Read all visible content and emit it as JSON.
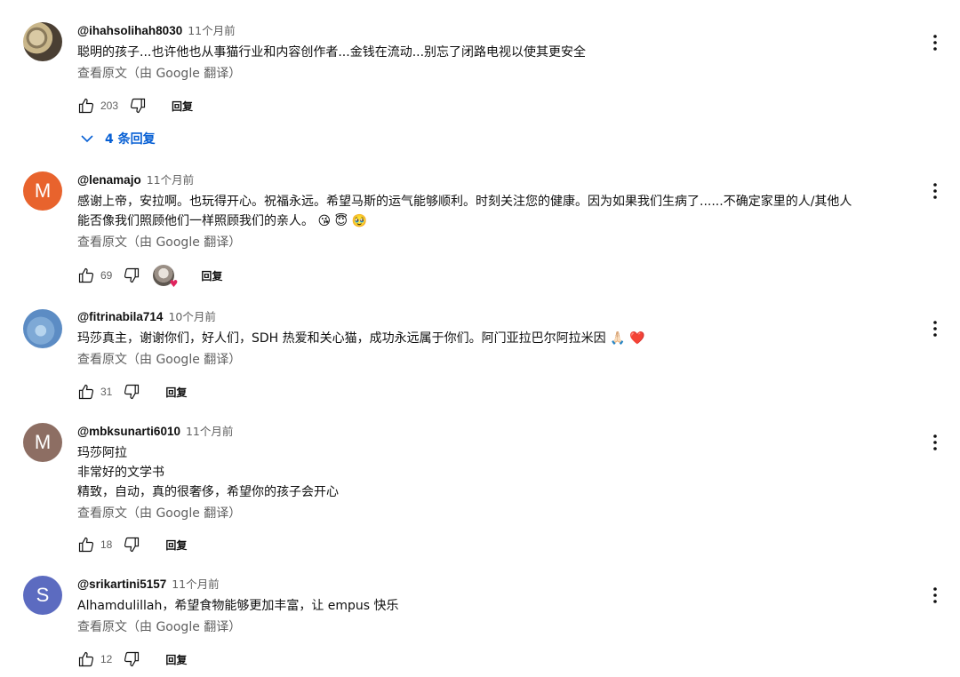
{
  "comments": [
    {
      "author": "@ihahsolihah8030",
      "time": "11个月前",
      "text": "聪明的孩子...也许他也从事猫行业和内容创作者...金钱在流动...别忘了闭路电视以使其更安全",
      "translate_link": "查看原文（由 Google 翻译）",
      "likes": "203",
      "reply_label": "回复",
      "replies_label": "4 条回复",
      "avatar_icon": "photo-avatar"
    },
    {
      "author": "@lenamajo",
      "time": "11个月前",
      "text": "感谢上帝，安拉啊。也玩得开心。祝福永远。希望马斯的运气能够顺利。时刻关注您的健康。因为如果我们生病了......不确定家里的人/其他人\n能否像我们照顾他们一样照顾我们的亲人。 😘 😇 🥹",
      "translate_link": "查看原文（由 Google 翻译）",
      "likes": "69",
      "reply_label": "回复",
      "avatar_letter": "M",
      "avatar_color": "#e8632d"
    },
    {
      "author": "@fitrinabila714",
      "time": "10个月前",
      "text": "玛莎真主，谢谢你们，好人们，SDH 热爱和关心猫，成功永远属于你们。阿门亚拉巴尔阿拉米因 🙏🏻 ❤️",
      "translate_link": "查看原文（由 Google 翻译）",
      "likes": "31",
      "reply_label": "回复",
      "avatar_icon": "sky-avatar"
    },
    {
      "author": "@mbksunarti6010",
      "time": "11个月前",
      "text": "玛莎阿拉\n非常好的文学书\n精致，自动，真的很奢侈，希望你的孩子会开心",
      "translate_link": "查看原文（由 Google 翻译）",
      "likes": "18",
      "reply_label": "回复",
      "avatar_letter": "M",
      "avatar_color": "#8d6e63"
    },
    {
      "author": "@srikartini5157",
      "time": "11个月前",
      "text": "Alhamdulillah，希望食物能够更加丰富，让 empus 快乐",
      "translate_link": "查看原文（由 Google 翻译）",
      "likes": "12",
      "reply_label": "回复",
      "avatar_letter": "S",
      "avatar_color": "#5c6bc0"
    }
  ]
}
